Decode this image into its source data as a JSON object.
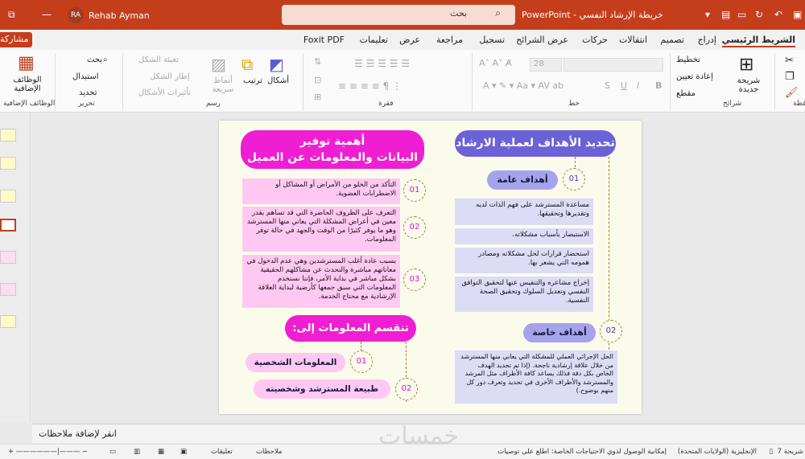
{
  "titlebar": {
    "doc_title": "خريطة الإرشاد النفسي  -  PowerPoint",
    "search_placeholder": "بحث",
    "user_name": "Rehab Ayman",
    "user_initials": "RA"
  },
  "tabs": [
    "الشريط الرئيسي",
    "إدراج",
    "تصميم",
    "انتقالات",
    "حركات",
    "عرض الشرائح",
    "تسجيل",
    "مراجعة",
    "عرض",
    "تعليمات",
    "Foxit PDF"
  ],
  "share_label": "مشاركة",
  "ribbon": {
    "clipboard": {
      "label": "حافظة"
    },
    "slides": {
      "label": "شرائح",
      "new_slide": "شريحة جديدة",
      "layout": "تخطيط",
      "reset": "إعادة تعيين",
      "section": "مقطع"
    },
    "font": {
      "label": "خط",
      "size": "28",
      "bold": "B",
      "italic": "I",
      "underline": "U",
      "shadow": "S"
    },
    "paragraph": {
      "label": "فقرة"
    },
    "drawing": {
      "label": "رسم",
      "shapes": "أشكال",
      "arrange": "ترتيب",
      "quick_styles": "أنماط سريعة",
      "fill": "تعبئة الشكل",
      "outline": "إطار الشكل",
      "effects": "تأثيرات الأشكال"
    },
    "editing": {
      "label": "تحرير",
      "find": "بحث",
      "replace": "استبدال",
      "select": "تحديد"
    },
    "addins": {
      "label": "الوظائف الإضافية",
      "button": "الوظائف الإضافية"
    }
  },
  "slide": {
    "right_title": "تحديد الأهداف لعملية الارشاد",
    "general_num": "01",
    "general_label": "أهداف عامة",
    "general_items": [
      "مساعدة المسترشد على فهم الذات لديه وتقديرها وتحقيقها.",
      "الاستبصار بأسباب مشكلاته.",
      "استحضار قرارات لحل مشكلاته ومصادر همومه التي يشعر بها.",
      "إخراج مشاعره والتنفيس عنها لتحقيق التوافق النفسي وتعديل السلوك وتحقيق الصحة النفسية."
    ],
    "special_num": "02",
    "special_label": "أهداف خاصة",
    "special_text": "الحل الإجرائي العملي للمشكلة التي يعاني منها المسترشد من خلال علاقة إرشادية ناجحة. (إذا تم تحديد الهدف الخاص بكل دقة فذلك يساعد كافة الأطراف مثل المرشد والمسترشد والأطراف الأخرى في تحديد وتعرف دور كل منهم بوضوح.)",
    "left_title_1": "أهمية توفير",
    "left_title_2": "البيانات والمعلومات عن العميل",
    "importance": [
      {
        "num": "01",
        "text": "التأكد من الخلو من الأمراض أو المشاكل أو الاضطرابات العضوية."
      },
      {
        "num": "02",
        "text": "التعرف على الظروف الحاضرة التي قد تساهم بقدر معين في أعراض المشكلة التي يعاني منها المسترشد وهو ما يوفر كثيرًا من الوقت والجهد في حالة توفر المعلومات."
      },
      {
        "num": "03",
        "text": "بسبب عادة أغلب المسترشدين وهي عدم الدخول في معاناتهم مباشرة والتحدث عن مشاكلهم الحقيقية بشكل مباشر في بداية الأمر، فإننا نستخدم المعلومات التي سبق جمعها كأرضية لبداية العلاقة الإرشادية مع محتاج الخدمة."
      }
    ],
    "divide_title": "تنقسم المعلومات إلى:",
    "divide": [
      {
        "num": "01",
        "label": "المعلومات الشخصية"
      },
      {
        "num": "02",
        "label": "طبيعة المسترشد وشخصيته"
      }
    ]
  },
  "notes_placeholder": "انقر لإضافة ملاحظات",
  "status": {
    "slide": "شريحة 7",
    "language": "الإنجليزية (الولايات المتحدة)",
    "accessibility": "إمكانية الوصول لذوي الاحتياجات الخاصة: اطلع على توصيات",
    "notes": "ملاحظات",
    "comments": "تعليقات"
  },
  "watermark": "خمسات",
  "colors": {
    "titlebar": "#c43e1c",
    "pink": "#f01ed2",
    "lavender": "#6b62d8",
    "pink_box": "#ffc8f2",
    "lav_box": "#dcdcf7"
  }
}
